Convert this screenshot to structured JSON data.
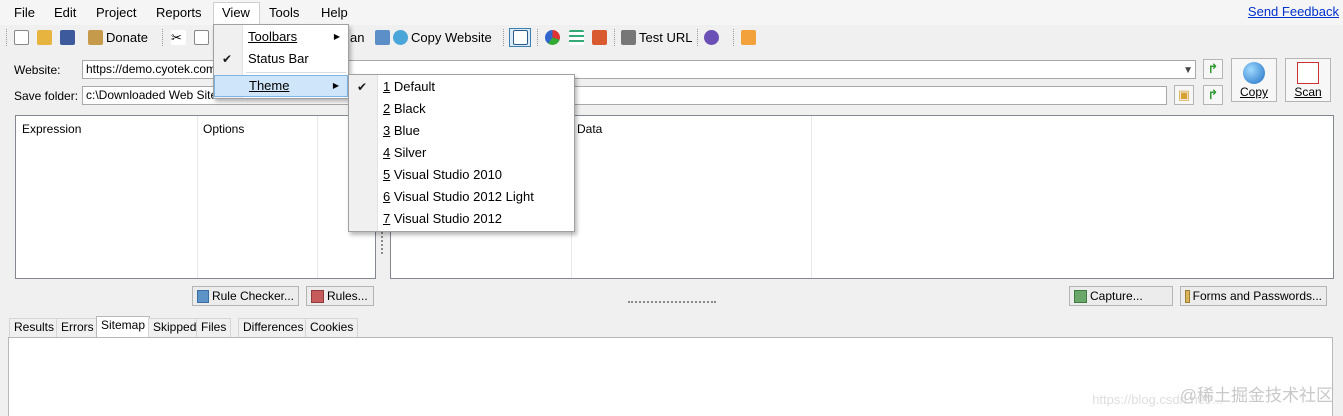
{
  "menubar": {
    "file": "File",
    "edit": "Edit",
    "project": "Project",
    "reports": "Reports",
    "view": "View",
    "tools": "Tools",
    "help": "Help",
    "feedback": "Send Feedback"
  },
  "toolbar": {
    "donate": "Donate",
    "scan_partial": "an",
    "copy_website": "Copy Website",
    "test_url": "Test URL"
  },
  "form": {
    "website_label": "Website:",
    "website_value": "https://demo.cyotek.com/",
    "save_label": "Save folder:",
    "save_value": "c:\\Downloaded Web Sites",
    "copy_btn": "Copy",
    "scan_btn": "Scan"
  },
  "left_panel": {
    "col1": "Expression",
    "col2": "Options"
  },
  "right_panel": {
    "col1": "Data"
  },
  "buttons": {
    "rule_checker": "Rule Checker...",
    "rules": "Rules...",
    "capture": "Capture...",
    "forms": "Forms and Passwords..."
  },
  "tabs": [
    "Results",
    "Errors",
    "Sitemap",
    "Skipped",
    "Files",
    "Differences",
    "Cookies"
  ],
  "view_menu": {
    "toolbars": "Toolbars",
    "status_bar": "Status Bar",
    "theme": "Theme"
  },
  "theme_menu": {
    "items": [
      {
        "num": "1",
        "label": " Default"
      },
      {
        "num": "2",
        "label": " Black"
      },
      {
        "num": "3",
        "label": " Blue"
      },
      {
        "num": "4",
        "label": " Silver"
      },
      {
        "num": "5",
        "label": " Visual Studio 2010"
      },
      {
        "num": "6",
        "label": " Visual Studio 2012 Light"
      },
      {
        "num": "7",
        "label": " Visual Studio 2012"
      }
    ],
    "checked": "1"
  },
  "watermark": "@稀土掘金技术社区",
  "watermark_url": "https://blog.csdn.net/..."
}
